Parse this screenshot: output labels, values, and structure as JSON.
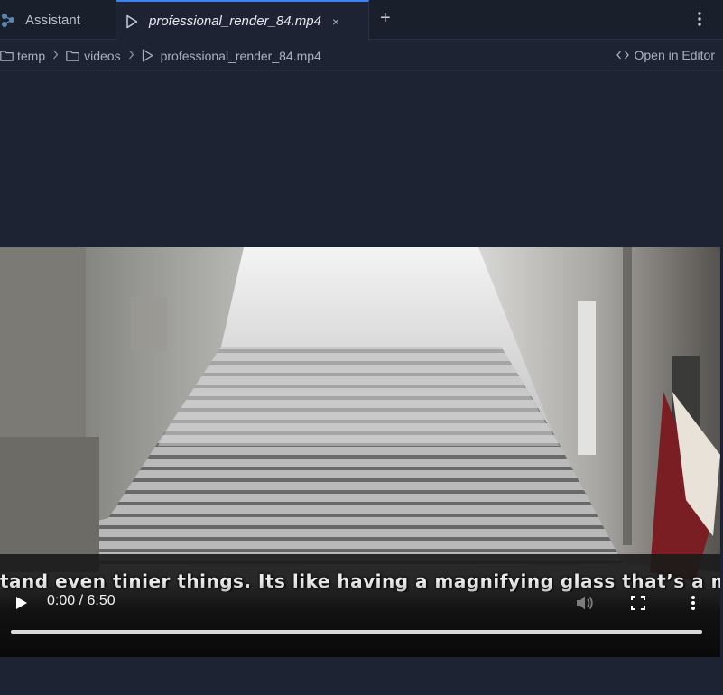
{
  "tabs": {
    "assistant_label": "Assistant",
    "video_label": "professional_render_84.mp4",
    "close_glyph": "×",
    "add_glyph": "+"
  },
  "breadcrumb": {
    "items": [
      "temp",
      "videos",
      "professional_render_84.mp4"
    ],
    "open_in_editor": "Open in Editor"
  },
  "video": {
    "subtitle": "tand even tinier things. Its like having a magnifying glass that’s a mill",
    "time_display": "0:00 / 6:50",
    "progress_fraction": 0.0
  },
  "colors": {
    "accent": "#3b82f6",
    "background": "#1e2334",
    "tabbar": "#1a1f2c"
  },
  "icons": {
    "assistant": "assistant-logo-icon",
    "video_tab": "play-icon",
    "folder": "folder-icon",
    "chevron": "chevron-right-icon",
    "code": "code-icon",
    "play": "play-icon",
    "volume": "volume-icon",
    "fullscreen": "fullscreen-icon",
    "more": "more-vertical-icon"
  }
}
